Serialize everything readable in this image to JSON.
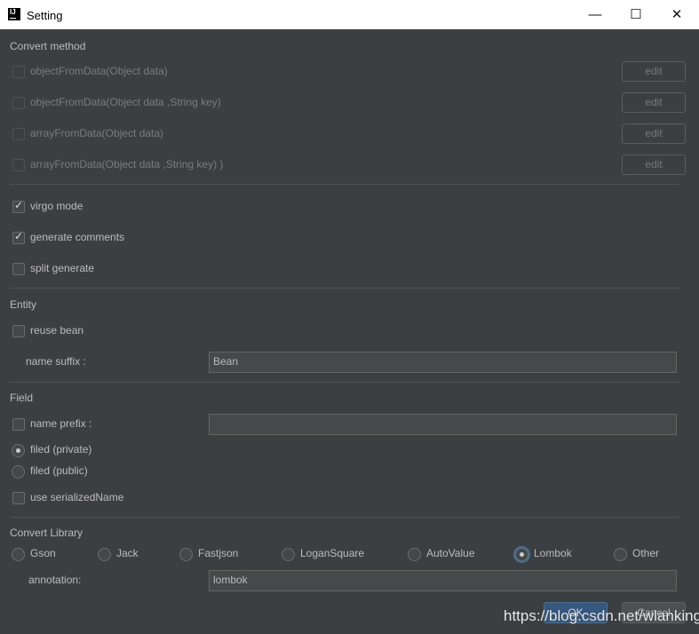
{
  "window": {
    "title": "Setting",
    "minimize": "—",
    "maximize": "☐",
    "close": "✕"
  },
  "convert_method": {
    "title": "Convert method",
    "items": [
      {
        "label": "objectFromData(Object data)",
        "checked": false,
        "edit": "edit"
      },
      {
        "label": "objectFromData(Object data ,String key)",
        "checked": false,
        "edit": "edit"
      },
      {
        "label": "arrayFromData(Object data)",
        "checked": false,
        "edit": "edit"
      },
      {
        "label": "arrayFromData(Object data ,String key) )",
        "checked": false,
        "edit": "edit"
      }
    ]
  },
  "options": [
    {
      "label": "virgo mode",
      "checked": true
    },
    {
      "label": "generate comments",
      "checked": true
    },
    {
      "label": "split generate",
      "checked": false
    }
  ],
  "entity": {
    "title": "Entity",
    "reuse_bean": "reuse bean",
    "name_suffix_label": "name suffix :",
    "name_suffix_value": "Bean"
  },
  "field": {
    "title": "Field",
    "name_prefix_label": "name prefix :",
    "name_prefix_value": "",
    "filed_private": "filed (private)",
    "filed_public": "filed (public)",
    "use_serialized": "use serializedName"
  },
  "library": {
    "title": "Convert Library",
    "options": [
      "Gson",
      "Jack",
      "Fastjson",
      "LoganSquare",
      "AutoValue",
      "Lombok",
      "Other"
    ],
    "selected": "Lombok",
    "annotation_label": "annotation:",
    "annotation_value": "lombok"
  },
  "buttons": {
    "ok": "OK",
    "cancel": "Cancel"
  },
  "watermark": "https://blog.csdn.net/wlanking"
}
